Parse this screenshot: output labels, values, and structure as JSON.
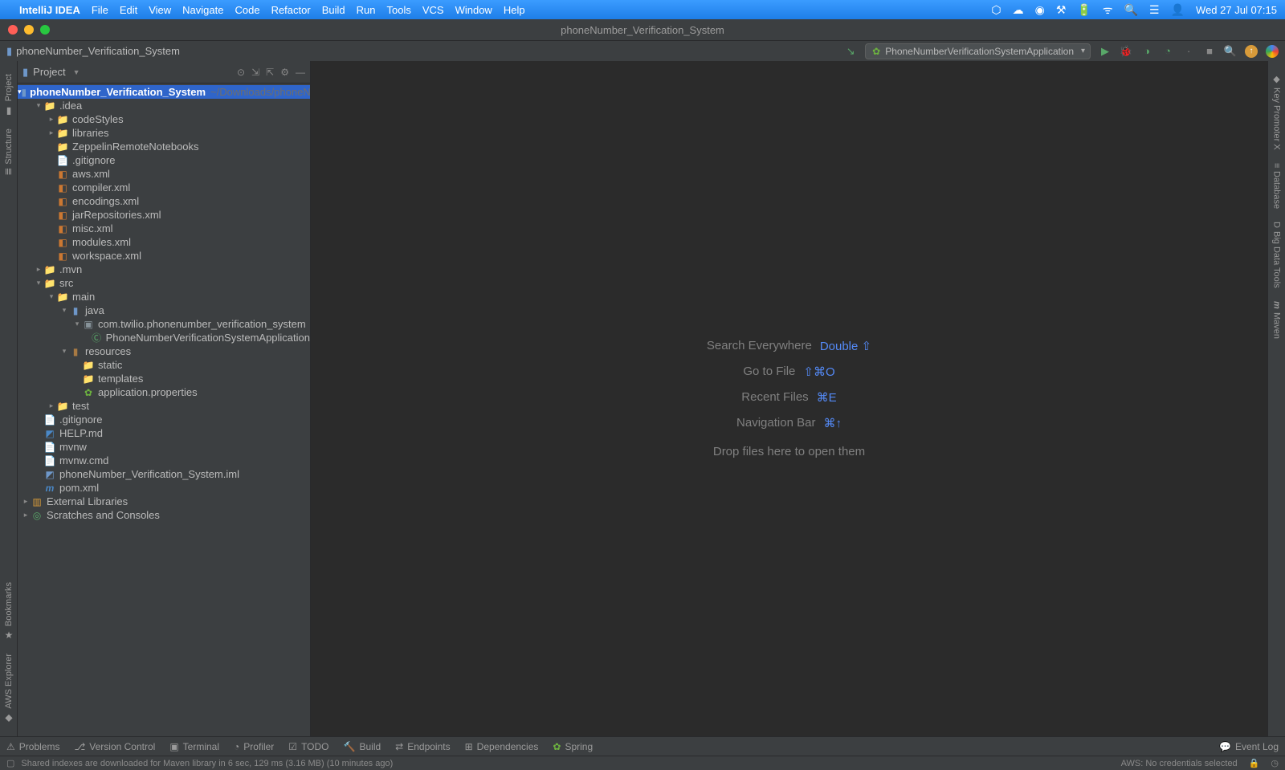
{
  "macos": {
    "app": "IntelliJ IDEA",
    "menus": [
      "File",
      "Edit",
      "View",
      "Navigate",
      "Code",
      "Refactor",
      "Build",
      "Run",
      "Tools",
      "VCS",
      "Window",
      "Help"
    ],
    "clock": "Wed 27 Jul  07:15"
  },
  "window": {
    "title": "phoneNumber_Verification_System"
  },
  "breadcrumb": {
    "project": "phoneNumber_Verification_System"
  },
  "runConfig": {
    "label": "PhoneNumberVerificationSystemApplication"
  },
  "projectPanel": {
    "title": "Project",
    "root": {
      "name": "phoneNumber_Verification_System",
      "path": "~/Downloads/phoneNumber_Verification_System"
    }
  },
  "tree": {
    "idea": ".idea",
    "codeStyles": "codeStyles",
    "libraries": "libraries",
    "zeppelin": "ZeppelinRemoteNotebooks",
    "gitignore1": ".gitignore",
    "aws": "aws.xml",
    "compiler": "compiler.xml",
    "encodings": "encodings.xml",
    "jarRepos": "jarRepositories.xml",
    "misc": "misc.xml",
    "modules": "modules.xml",
    "workspace": "workspace.xml",
    "mvn": ".mvn",
    "src": "src",
    "main": "main",
    "java": "java",
    "pkg": "com.twilio.phonenumber_verification_system",
    "appClass": "PhoneNumberVerificationSystemApplication",
    "resources": "resources",
    "static": "static",
    "templates": "templates",
    "appProps": "application.properties",
    "test": "test",
    "gitignore2": ".gitignore",
    "help": "HELP.md",
    "mvnw": "mvnw",
    "mvnwcmd": "mvnw.cmd",
    "iml": "phoneNumber_Verification_System.iml",
    "pom": "pom.xml",
    "extLib": "External Libraries",
    "scratches": "Scratches and Consoles"
  },
  "gutters": {
    "left": {
      "project": "Project",
      "structure": "Structure",
      "bookmarks": "Bookmarks",
      "aws": "AWS Explorer"
    },
    "right": {
      "key": "Key Promoter X",
      "db": "Database",
      "bigdata": "Big Data Tools",
      "maven": "Maven"
    }
  },
  "hints": {
    "search": {
      "label": "Search Everywhere",
      "shortcut": "Double ⇧"
    },
    "gotofile": {
      "label": "Go to File",
      "shortcut": "⇧⌘O"
    },
    "recent": {
      "label": "Recent Files",
      "shortcut": "⌘E"
    },
    "navbar": {
      "label": "Navigation Bar",
      "shortcut": "⌘↑"
    },
    "drop": "Drop files here to open them"
  },
  "bottom": {
    "problems": "Problems",
    "vcs": "Version Control",
    "terminal": "Terminal",
    "profiler": "Profiler",
    "todo": "TODO",
    "build": "Build",
    "endpoints": "Endpoints",
    "deps": "Dependencies",
    "spring": "Spring",
    "eventlog": "Event Log"
  },
  "status": {
    "msg": "Shared indexes are downloaded for Maven library in 6 sec, 129 ms (3.16 MB) (10 minutes ago)",
    "aws": "AWS: No credentials selected"
  }
}
